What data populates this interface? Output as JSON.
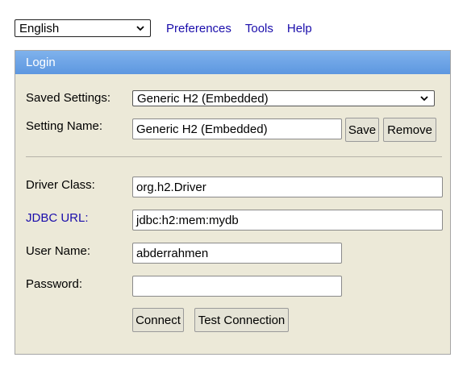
{
  "topbar": {
    "language": "English",
    "links": [
      "Preferences",
      "Tools",
      "Help"
    ]
  },
  "login": {
    "title": "Login",
    "saved_settings_label": "Saved Settings:",
    "saved_settings_value": "Generic H2 (Embedded)",
    "setting_name_label": "Setting Name:",
    "setting_name_value": "Generic H2 (Embedded)",
    "save_label": "Save",
    "remove_label": "Remove",
    "driver_class_label": "Driver Class:",
    "driver_class_value": "org.h2.Driver",
    "jdbc_url_label": "JDBC URL:",
    "jdbc_url_value": "jdbc:h2:mem:mydb",
    "user_name_label": "User Name:",
    "user_name_value": "abderrahmen",
    "password_label": "Password:",
    "password_value": "",
    "connect_label": "Connect",
    "test_connection_label": "Test Connection"
  },
  "colors": {
    "header_gradient_top": "#7fb2ec",
    "header_gradient_bottom": "#5d97e0",
    "panel_bg": "#ece9d8",
    "link": "#1a0dab"
  }
}
